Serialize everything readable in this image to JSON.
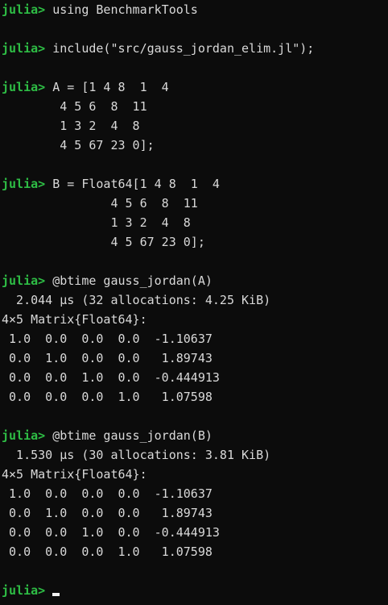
{
  "terminal": {
    "prompt": "julia>",
    "colors": {
      "background": "#0c0c0c",
      "text": "#d9d9d9",
      "prompt": "#2ebd45"
    },
    "lines": [
      {
        "type": "input",
        "text": " using BenchmarkTools"
      },
      {
        "type": "blank",
        "text": ""
      },
      {
        "type": "input",
        "text": " include(\"src/gauss_jordan_elim.jl\");"
      },
      {
        "type": "blank",
        "text": ""
      },
      {
        "type": "input",
        "text": " A = [1 4 8  1  4"
      },
      {
        "type": "output",
        "text": "        4 5 6  8  11"
      },
      {
        "type": "output",
        "text": "        1 3 2  4  8"
      },
      {
        "type": "output",
        "text": "        4 5 67 23 0];"
      },
      {
        "type": "blank",
        "text": ""
      },
      {
        "type": "input",
        "text": " B = Float64[1 4 8  1  4"
      },
      {
        "type": "output",
        "text": "               4 5 6  8  11"
      },
      {
        "type": "output",
        "text": "               1 3 2  4  8"
      },
      {
        "type": "output",
        "text": "               4 5 67 23 0];"
      },
      {
        "type": "blank",
        "text": ""
      },
      {
        "type": "input",
        "text": " @btime gauss_jordan(A)"
      },
      {
        "type": "output",
        "text": "  2.044 μs (32 allocations: 4.25 KiB)"
      },
      {
        "type": "output",
        "text": "4×5 Matrix{Float64}:"
      },
      {
        "type": "output",
        "text": " 1.0  0.0  0.0  0.0  -1.10637"
      },
      {
        "type": "output",
        "text": " 0.0  1.0  0.0  0.0   1.89743"
      },
      {
        "type": "output",
        "text": " 0.0  0.0  1.0  0.0  -0.444913"
      },
      {
        "type": "output",
        "text": " 0.0  0.0  0.0  1.0   1.07598"
      },
      {
        "type": "blank",
        "text": ""
      },
      {
        "type": "input",
        "text": " @btime gauss_jordan(B)"
      },
      {
        "type": "output",
        "text": "  1.530 μs (30 allocations: 3.81 KiB)"
      },
      {
        "type": "output",
        "text": "4×5 Matrix{Float64}:"
      },
      {
        "type": "output",
        "text": " 1.0  0.0  0.0  0.0  -1.10637"
      },
      {
        "type": "output",
        "text": " 0.0  1.0  0.0  0.0   1.89743"
      },
      {
        "type": "output",
        "text": " 0.0  0.0  1.0  0.0  -0.444913"
      },
      {
        "type": "output",
        "text": " 0.0  0.0  0.0  1.0   1.07598"
      },
      {
        "type": "blank",
        "text": ""
      },
      {
        "type": "cursor",
        "text": " "
      }
    ]
  }
}
